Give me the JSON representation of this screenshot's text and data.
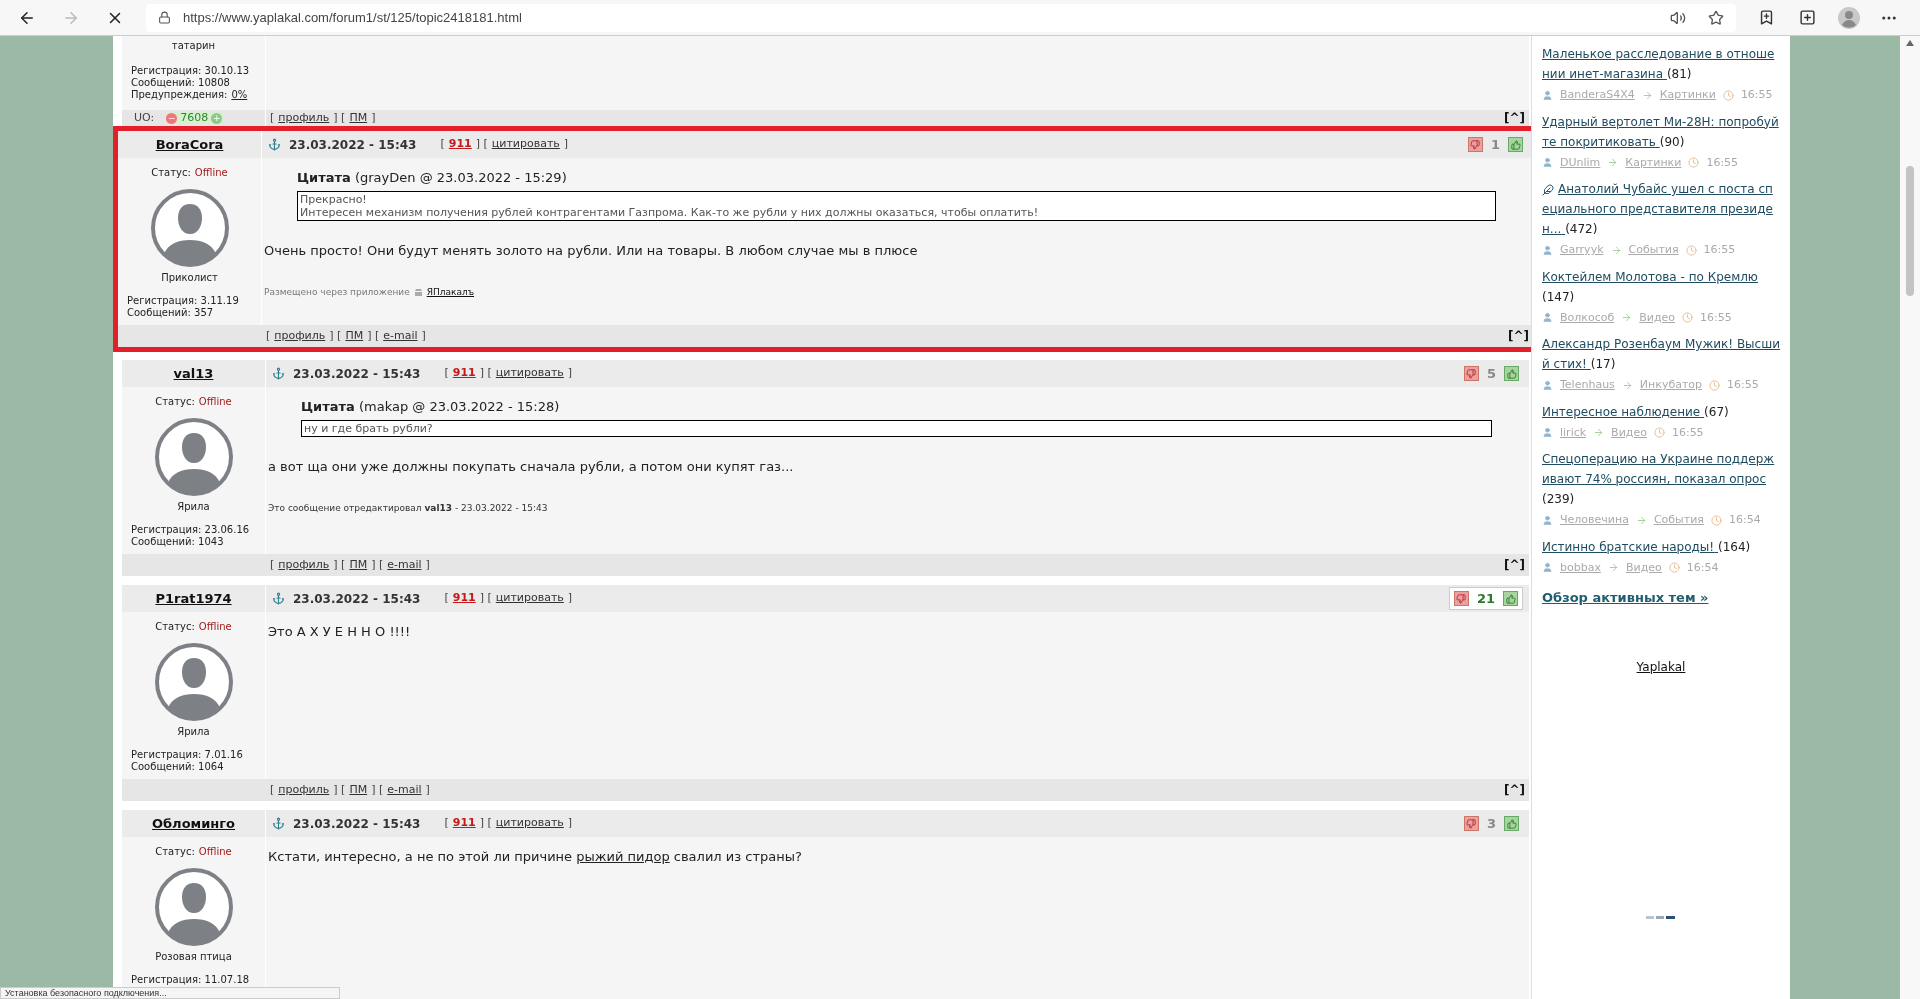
{
  "browser": {
    "url": "https://www.yaplakal.com/forum1/st/125/topic2418181.html",
    "status": "Установка безопасного подключения..."
  },
  "top_post": {
    "title": "татарин",
    "registration": "Регистрация: 30.10.13",
    "messages": "Сообщений: 10808",
    "warnings_label": "Предупреждения:",
    "warnings_value": "0%",
    "uo_label": "UO:",
    "uo_minus": "−",
    "uo_value": "7608",
    "uo_plus": "+",
    "footer": [
      {
        "kind": "text",
        "text": "["
      },
      {
        "kind": "link",
        "text": "профиль"
      },
      {
        "kind": "text",
        "text": "] ["
      },
      {
        "kind": "link",
        "text": "ПМ"
      },
      {
        "kind": "text",
        "text": "]"
      }
    ],
    "top_link": "[^]"
  },
  "posts": [
    {
      "user": "BoraCora",
      "highlighted": true,
      "status_label": "Статус:",
      "status": "Offline",
      "title": "Приколист",
      "registration": "Регистрация: 3.11.19",
      "messages": "Сообщений: 357",
      "date": "23.03.2022 - 15:43",
      "header": [
        {
          "kind": "text",
          "text": "["
        },
        {
          "kind": "num",
          "text": "911"
        },
        {
          "kind": "text",
          "text": "] ["
        },
        {
          "kind": "link",
          "text": "цитировать"
        },
        {
          "kind": "text",
          "text": "]"
        }
      ],
      "rating": {
        "count": "1",
        "highlighted": false
      },
      "quote": {
        "label": "Цитата",
        "source": "(grayDen @ 23.03.2022 - 15:29)",
        "lines": [
          "Прекрасно!",
          "Интересен механизм получения рублей контрагентами Газпрома. Как-то же рубли у них должны оказаться, чтобы оплатить!"
        ]
      },
      "body": [
        {
          "kind": "text",
          "text": "Очень просто! Они будут менять золото на рубли. Или на товары. В любом случае мы в плюсе"
        }
      ],
      "note": {
        "kind": "app",
        "text": "Размещено через приложение",
        "link": "ЯПлакалъ"
      },
      "footer": [
        {
          "kind": "text",
          "text": "["
        },
        {
          "kind": "link",
          "text": "профиль"
        },
        {
          "kind": "text",
          "text": "] ["
        },
        {
          "kind": "link",
          "text": "ПМ"
        },
        {
          "kind": "text",
          "text": "] ["
        },
        {
          "kind": "link",
          "text": "e-mail"
        },
        {
          "kind": "text",
          "text": "]"
        }
      ],
      "top_link": "[^]"
    },
    {
      "user": "val13",
      "highlighted": false,
      "status_label": "Статус:",
      "status": "Offline",
      "title": "Ярила",
      "registration": "Регистрация: 23.06.16",
      "messages": "Сообщений: 1043",
      "date": "23.03.2022 - 15:43",
      "header": [
        {
          "kind": "text",
          "text": "["
        },
        {
          "kind": "num",
          "text": "911"
        },
        {
          "kind": "text",
          "text": "] ["
        },
        {
          "kind": "link",
          "text": "цитировать"
        },
        {
          "kind": "text",
          "text": "]"
        }
      ],
      "rating": {
        "count": "5",
        "highlighted": false
      },
      "quote": {
        "label": "Цитата",
        "source": "(makap @ 23.03.2022 - 15:28)",
        "lines": [
          "ну и где брать рубли?"
        ]
      },
      "body": [
        {
          "kind": "text",
          "text": "а вот ща они уже должны покупать сначала рубли, а потом они купят газ..."
        }
      ],
      "note": {
        "kind": "edit",
        "text": "Это сообщение отредактировал **val13** - 23.03.2022 - 15:43"
      },
      "footer": [
        {
          "kind": "text",
          "text": "["
        },
        {
          "kind": "link",
          "text": "профиль"
        },
        {
          "kind": "text",
          "text": "] ["
        },
        {
          "kind": "link",
          "text": "ПМ"
        },
        {
          "kind": "text",
          "text": "] ["
        },
        {
          "kind": "link",
          "text": "e-mail"
        },
        {
          "kind": "text",
          "text": "]"
        }
      ],
      "top_link": "[^]"
    },
    {
      "user": "P1rat1974",
      "highlighted": false,
      "status_label": "Статус:",
      "status": "Offline",
      "title": "Ярила",
      "registration": "Регистрация: 7.01.16",
      "messages": "Сообщений: 1064",
      "date": "23.03.2022 - 15:43",
      "header": [
        {
          "kind": "text",
          "text": "["
        },
        {
          "kind": "num",
          "text": "911"
        },
        {
          "kind": "text",
          "text": "] ["
        },
        {
          "kind": "link",
          "text": "цитировать"
        },
        {
          "kind": "text",
          "text": "]"
        }
      ],
      "rating": {
        "count": "21",
        "highlighted": true
      },
      "body": [
        {
          "kind": "text",
          "text": "Это А Х У Е Н Н О !!!!"
        }
      ],
      "footer": [
        {
          "kind": "text",
          "text": "["
        },
        {
          "kind": "link",
          "text": "профиль"
        },
        {
          "kind": "text",
          "text": "] ["
        },
        {
          "kind": "link",
          "text": "ПМ"
        },
        {
          "kind": "text",
          "text": "] ["
        },
        {
          "kind": "link",
          "text": "e-mail"
        },
        {
          "kind": "text",
          "text": "]"
        }
      ],
      "top_link": "[^]"
    },
    {
      "user": "Обломинго",
      "highlighted": false,
      "status_label": "Статус:",
      "status": "Offline",
      "title": "Розовая птица",
      "registration": "Регистрация: 11.07.18",
      "date": "23.03.2022 - 15:43",
      "header": [
        {
          "kind": "text",
          "text": "["
        },
        {
          "kind": "num",
          "text": "911"
        },
        {
          "kind": "text",
          "text": "] ["
        },
        {
          "kind": "link",
          "text": "цитировать"
        },
        {
          "kind": "text",
          "text": "]"
        }
      ],
      "rating": {
        "count": "3",
        "highlighted": false
      },
      "body": [
        {
          "kind": "text",
          "text": "Кстати, интересно, а не по этой ли причине"
        },
        {
          "kind": "link",
          "text": "рыжий пидор"
        },
        {
          "kind": "text",
          "text": "свалил из страны?"
        }
      ]
    }
  ],
  "sidebar": {
    "topics": [
      {
        "title": "Маленькое расследование в отношении инет-магазина",
        "count": "(81)",
        "marked": false,
        "author": "BanderaS4X4",
        "category": "Картинки",
        "time": "16:55"
      },
      {
        "title": "Ударный вертолет Ми-28Н: попробуйте покритиковать",
        "count": "(90)",
        "marked": false,
        "author": "DUnlim",
        "category": "Картинки",
        "time": "16:55"
      },
      {
        "title": "Анатолий Чубайс ушел с поста специального представителя президен...",
        "count": "(472)",
        "marked": true,
        "author": "Garryyk",
        "category": "События",
        "time": "16:55"
      },
      {
        "title": "Коктейлем Молотова - по Кремлю",
        "count": "(147)",
        "marked": false,
        "author": "Волкособ",
        "category": "Видео",
        "time": "16:55"
      },
      {
        "title": "Александр Розенбаум Мужик! Высший стих!",
        "count": "(17)",
        "marked": false,
        "author": "Telenhaus",
        "category": "Инкубатор",
        "time": "16:55"
      },
      {
        "title": "Интересное наблюдение",
        "count": "(67)",
        "marked": false,
        "author": "lirick",
        "category": "Видео",
        "time": "16:55"
      },
      {
        "title": "Спецоперацию на Украине поддерживают 74% россиян, показал опрос",
        "count": "(239)",
        "marked": false,
        "author": "Человечина",
        "category": "События",
        "time": "16:54"
      },
      {
        "title": "Истинно братские народы!",
        "count": "(164)",
        "marked": false,
        "author": "bobbax",
        "category": "Видео",
        "time": "16:54"
      }
    ],
    "overview": "Обзор активных тем »",
    "site_link": "Yaplakal"
  }
}
